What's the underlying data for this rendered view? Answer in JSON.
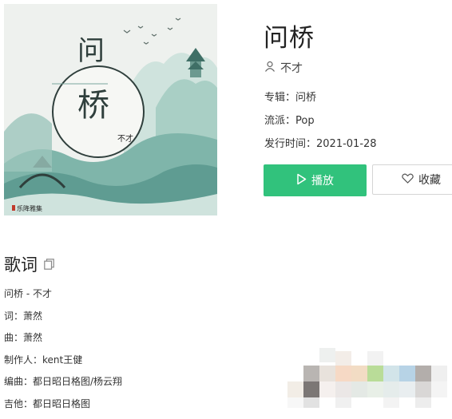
{
  "song": {
    "title": "问桥",
    "artist": "不才",
    "album_label": "专辑：",
    "album": "问桥",
    "genre_label": "流派：",
    "genre": "Pop",
    "release_label": "发行时间：",
    "release_date": "2021-01-28"
  },
  "cover": {
    "title_text": "问桥",
    "artist_text": "不才",
    "brand_text": "乐降雅集"
  },
  "actions": {
    "play_label": "播放",
    "favorite_label": "收藏"
  },
  "lyrics": {
    "heading": "歌词",
    "lines": [
      "问桥 - 不才",
      "词：萧然",
      "曲：萧然",
      "制作人：kent王健",
      "编曲：都日昭日格图/杨云翔",
      "吉他：都日昭日格图"
    ]
  },
  "icons": {
    "user": "user-icon",
    "play": "play-icon",
    "heart": "heart-icon",
    "copy": "copy-icon"
  },
  "colors": {
    "accent": "#31c27c",
    "cover_teal": "#7fb5aa"
  }
}
